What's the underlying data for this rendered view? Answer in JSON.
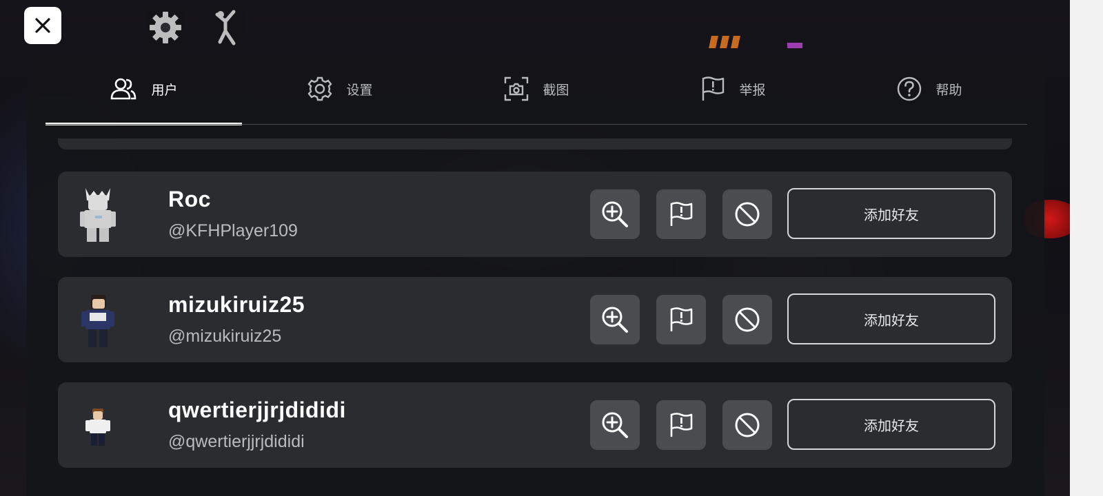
{
  "tabs": [
    {
      "label": "用户",
      "icon": "users-icon",
      "active": true
    },
    {
      "label": "设置",
      "icon": "gear-icon",
      "active": false
    },
    {
      "label": "截图",
      "icon": "screenshot-icon",
      "active": false
    },
    {
      "label": "举报",
      "icon": "flag-icon",
      "active": false
    },
    {
      "label": "帮助",
      "icon": "help-icon",
      "active": false
    }
  ],
  "players": [
    {
      "display_name": "Roc",
      "username": "@KFHPlayer109",
      "add_friend_label": "添加好友"
    },
    {
      "display_name": "mizukiruiz25",
      "username": "@mizukiruiz25",
      "add_friend_label": "添加好友"
    },
    {
      "display_name": "qwertierjjrjdididi",
      "username": "@qwertierjjrjdididi",
      "add_friend_label": "添加好友"
    }
  ],
  "colors": {
    "panel_bg": "#141518",
    "row_bg": "#2b2c2f",
    "icon_button_bg": "#4b4c50",
    "active_tab_underline": "#ffffff"
  }
}
